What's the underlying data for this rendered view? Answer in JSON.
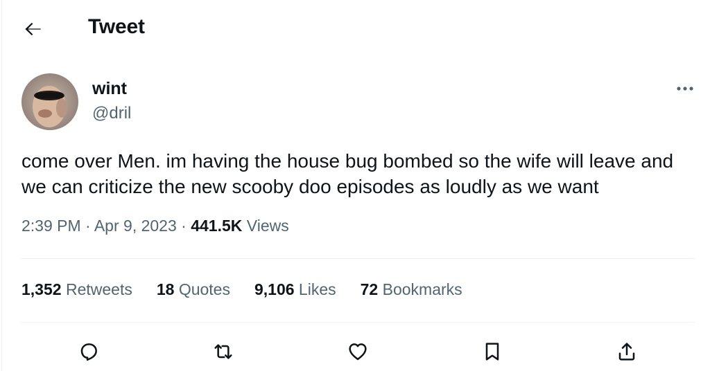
{
  "header": {
    "title": "Tweet",
    "back_icon": "arrow-left-icon"
  },
  "author": {
    "name": "wint",
    "handle": "@dril",
    "more_icon": "more-horizontal-icon"
  },
  "tweet": {
    "text": "come over Men. im having the house bug bombed so the wife will leave and we can criticize the new scooby doo episodes as loudly as we want",
    "time": "2:39 PM",
    "date": "Apr 9, 2023",
    "separator": "·",
    "views_count": "441.5K",
    "views_label": "Views"
  },
  "stats": [
    {
      "count": "1,352",
      "label": "Retweets"
    },
    {
      "count": "18",
      "label": "Quotes"
    },
    {
      "count": "9,106",
      "label": "Likes"
    },
    {
      "count": "72",
      "label": "Bookmarks"
    }
  ],
  "actions": [
    {
      "icon": "reply-icon"
    },
    {
      "icon": "retweet-icon"
    },
    {
      "icon": "like-icon"
    },
    {
      "icon": "bookmark-icon"
    },
    {
      "icon": "share-icon"
    }
  ],
  "colors": {
    "text": "#0f1419",
    "secondary": "#536471",
    "divider": "#eff3f4",
    "background": "#ffffff"
  }
}
